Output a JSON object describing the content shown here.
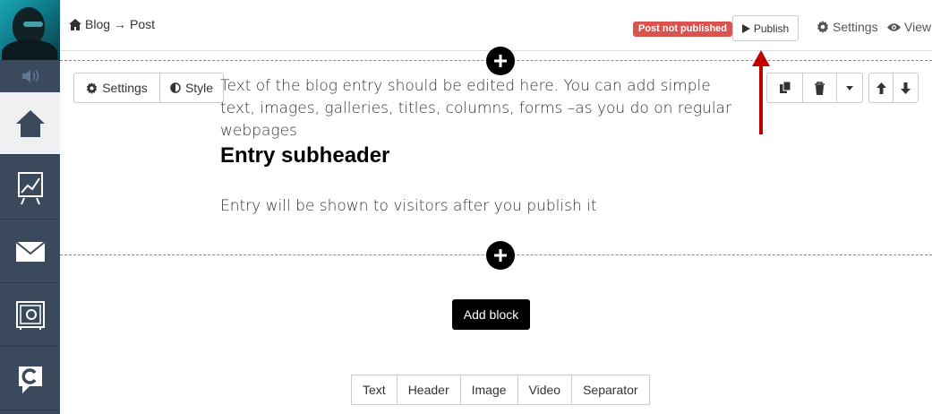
{
  "breadcrumb": {
    "home": "Blog",
    "separator": "→",
    "current": "Post"
  },
  "status_badge": "Post not published",
  "publish_label": "Publish",
  "top_settings_label": "Settings",
  "view_label": "View",
  "block_toolbar": {
    "settings_label": "Settings",
    "style_label": "Style"
  },
  "content": {
    "paragraph": "Text of the blog entry should be edited here. You can add simple text, images, galleries, titles, columns, forms –as you do on regular webpages",
    "subheader": "Entry subheader",
    "note": "Entry will be shown to visitors after you publish it"
  },
  "add_block_label": "Add block",
  "block_types": [
    "Text",
    "Header",
    "Image",
    "Video",
    "Separator"
  ],
  "colors": {
    "sidebar": "#3a4a5c",
    "badge": "#d9534f",
    "arrow": "#c00000"
  },
  "sidebar_icons": [
    "speaker-icon",
    "home-icon",
    "chart-icon",
    "mail-icon",
    "safe-icon",
    "chat-icon"
  ]
}
